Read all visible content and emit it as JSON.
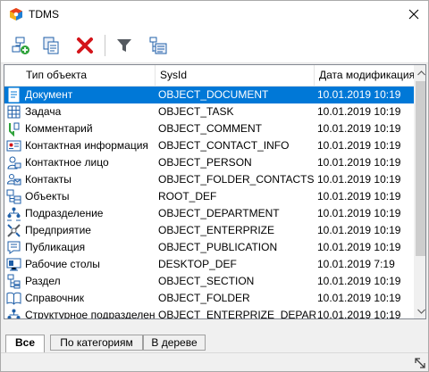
{
  "window": {
    "title": "TDMS"
  },
  "toolbar": {
    "buttons": [
      {
        "name": "add-object-button",
        "icon": "add-object-icon"
      },
      {
        "name": "copy-object-button",
        "icon": "copy-object-icon"
      },
      {
        "name": "delete-button",
        "icon": "delete-icon"
      },
      {
        "name": "filter-button",
        "icon": "filter-icon"
      },
      {
        "name": "properties-button",
        "icon": "properties-icon"
      }
    ]
  },
  "grid": {
    "columns": [
      "Тип объекта",
      "SysId",
      "Дата модификация"
    ],
    "rows": [
      {
        "type": "Документ",
        "sysid": "OBJECT_DOCUMENT",
        "date": "10.01.2019 10:19",
        "icon": "document-icon",
        "selected": true
      },
      {
        "type": "Задача",
        "sysid": "OBJECT_TASK",
        "date": "10.01.2019 10:19",
        "icon": "task-icon"
      },
      {
        "type": "Комментарий",
        "sysid": "OBJECT_COMMENT",
        "date": "10.01.2019 10:19",
        "icon": "comment-icon"
      },
      {
        "type": "Контактная информация",
        "sysid": "OBJECT_CONTACT_INFO",
        "date": "10.01.2019 10:19",
        "icon": "contact-info-icon"
      },
      {
        "type": "Контактное лицо",
        "sysid": "OBJECT_PERSON",
        "date": "10.01.2019 10:19",
        "icon": "person-icon"
      },
      {
        "type": "Контакты",
        "sysid": "OBJECT_FOLDER_CONTACTS",
        "date": "10.01.2019 10:19",
        "icon": "contacts-icon"
      },
      {
        "type": "Объекты",
        "sysid": "ROOT_DEF",
        "date": "10.01.2019 10:19",
        "icon": "objects-icon"
      },
      {
        "type": "Подразделение",
        "sysid": "OBJECT_DEPARTMENT",
        "date": "10.01.2019 10:19",
        "icon": "department-icon"
      },
      {
        "type": "Предприятие",
        "sysid": "OBJECT_ENTERPRIZE",
        "date": "10.01.2019 10:19",
        "icon": "enterprise-icon"
      },
      {
        "type": "Публикация",
        "sysid": "OBJECT_PUBLICATION",
        "date": "10.01.2019 10:19",
        "icon": "publication-icon"
      },
      {
        "type": "Рабочие столы",
        "sysid": "DESKTOP_DEF",
        "date": "10.01.2019 7:19",
        "icon": "desktop-icon"
      },
      {
        "type": "Раздел",
        "sysid": "OBJECT_SECTION",
        "date": "10.01.2019 10:19",
        "icon": "section-icon"
      },
      {
        "type": "Справочник",
        "sysid": "OBJECT_FOLDER",
        "date": "10.01.2019 10:19",
        "icon": "folder-book-icon"
      },
      {
        "type": "Структурное подразделение",
        "sysid": "OBJECT_ENTERPRIZE_DEPART",
        "date": "10.01.2019 10:19",
        "icon": "structure-icon"
      }
    ]
  },
  "tabs": [
    {
      "label": "Все",
      "active": true
    },
    {
      "label": "По категориям",
      "active": false
    },
    {
      "label": "В дереве",
      "active": false
    }
  ],
  "colors": {
    "selection": "#0078d7",
    "delete": "#d4141a",
    "accent_green": "#2ea23a"
  }
}
